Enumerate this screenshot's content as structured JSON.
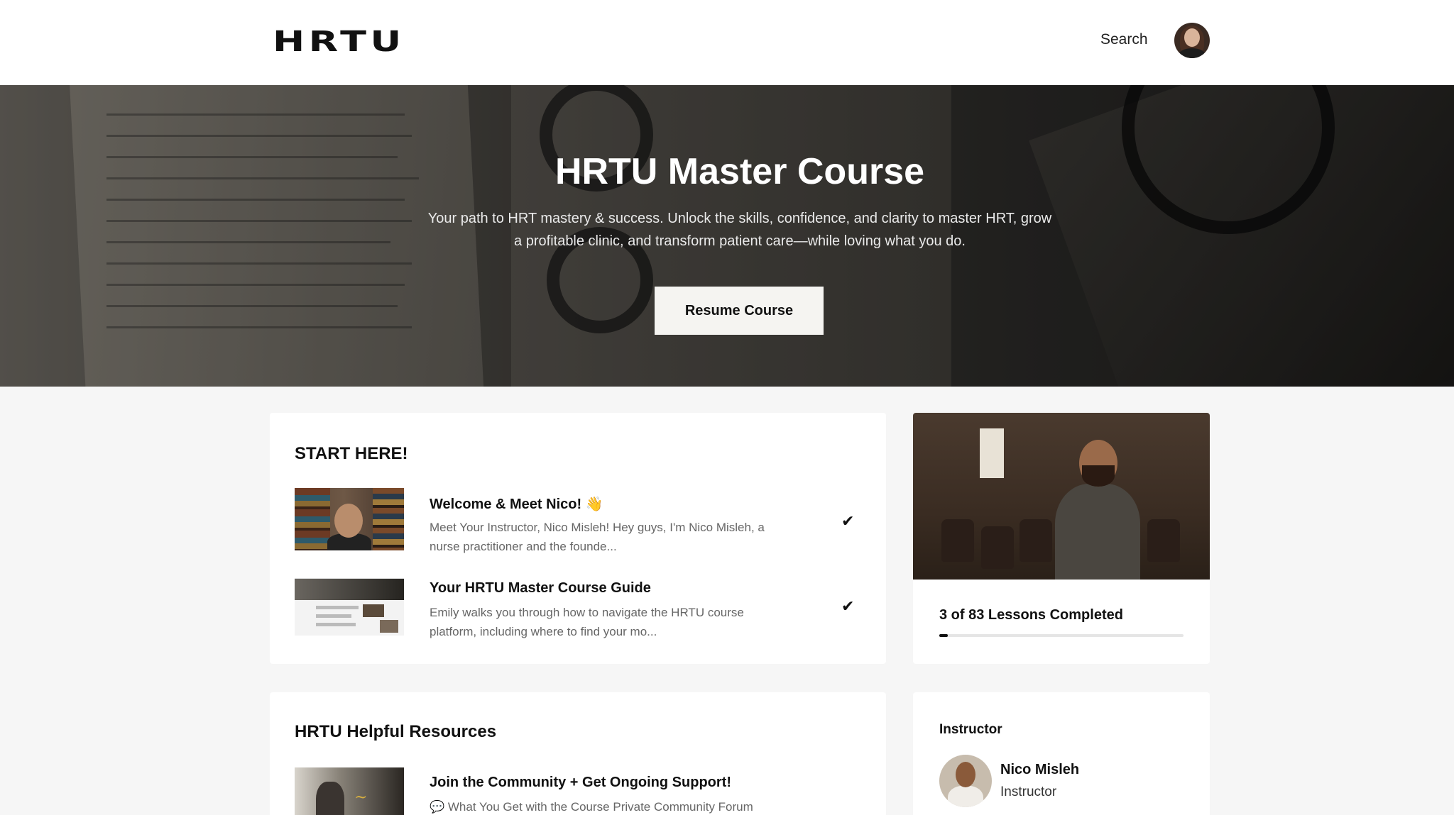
{
  "header": {
    "logo_text": "HRTU",
    "search_label": "Search",
    "avatar_alt": "user-avatar"
  },
  "hero": {
    "title": "HRTU Master Course",
    "subtitle": "Your path to HRT mastery & success. Unlock the skills, confidence, and clarity to master HRT, grow a profitable clinic, and transform patient care—while loving what you do.",
    "resume_button": "Resume Course"
  },
  "start_here": {
    "title": "START HERE!",
    "lessons": [
      {
        "title": "Welcome & Meet Nico! 👋",
        "description": "Meet Your Instructor, Nico Misleh! Hey guys, I'm Nico Misleh, a nurse practitioner and the founde...",
        "completed": true,
        "check_icon": "checkmark-icon"
      },
      {
        "title": "Your HRTU Master Course Guide",
        "description": "Emily walks you through how to navigate the HRTU course platform, including where to find your mo...",
        "completed": true,
        "check_icon": "checkmark-icon"
      }
    ]
  },
  "progress": {
    "lessons_completed_text": "3 of 83 Lessons Completed",
    "completed": 3,
    "total": 83
  },
  "resources": {
    "title": "HRTU Helpful Resources",
    "lessons": [
      {
        "title": "Join the Community + Get Ongoing Support!",
        "description": "💬 What You Get with the Course Private Community Forum"
      }
    ]
  },
  "instructor": {
    "label": "Instructor",
    "name": "Nico Misleh",
    "role": "Instructor"
  },
  "colors": {
    "accent": "#111111",
    "page_background": "#f6f6f6",
    "card_background": "#ffffff",
    "muted_text": "#666666"
  }
}
